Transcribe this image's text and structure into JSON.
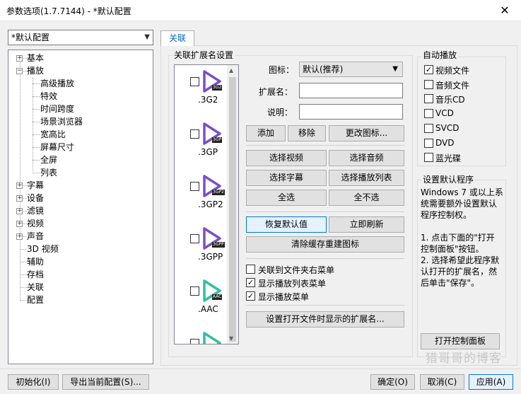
{
  "window": {
    "title": "参数选项(1.7.7144) - *默认配置",
    "close_glyph": "✕"
  },
  "profile": {
    "value": "*默认配置"
  },
  "tree": {
    "items": [
      {
        "label": "基本",
        "level": 0,
        "expander": "+"
      },
      {
        "label": "播放",
        "level": 0,
        "expander": "−"
      },
      {
        "label": "高级播放",
        "level": 1
      },
      {
        "label": "特效",
        "level": 1
      },
      {
        "label": "时间跨度",
        "level": 1
      },
      {
        "label": "场景浏览器",
        "level": 1
      },
      {
        "label": "宽高比",
        "level": 1
      },
      {
        "label": "屏幕尺寸",
        "level": 1
      },
      {
        "label": "全屏",
        "level": 1
      },
      {
        "label": "列表",
        "level": 1
      },
      {
        "label": "字幕",
        "level": 0,
        "expander": "+"
      },
      {
        "label": "设备",
        "level": 0,
        "expander": "+"
      },
      {
        "label": "滤镜",
        "level": 0,
        "expander": "+"
      },
      {
        "label": "视频",
        "level": 0,
        "expander": "+"
      },
      {
        "label": "声音",
        "level": 0,
        "expander": "+"
      },
      {
        "label": "3D 视频",
        "level": 0
      },
      {
        "label": "辅助",
        "level": 0
      },
      {
        "label": "存档",
        "level": 0
      },
      {
        "label": "关联",
        "level": 0
      },
      {
        "label": "配置",
        "level": 0
      }
    ]
  },
  "tab": {
    "label": "关联"
  },
  "assoc": {
    "group_title": "关联扩展名设置",
    "files": [
      {
        "badge": "3G2",
        "label": ".3G2",
        "color": "#7b4fc8"
      },
      {
        "badge": "3GP",
        "label": ".3GP",
        "color": "#7b4fc8"
      },
      {
        "badge": "3GP2",
        "label": ".3GP2",
        "color": "#7b4fc8"
      },
      {
        "badge": "3GPP",
        "label": ".3GPP",
        "color": "#7b4fc8"
      },
      {
        "badge": "AAC",
        "label": ".AAC",
        "color": "#2fbfa0"
      },
      {
        "badge": "",
        "label": "",
        "color": "#2fbfa0"
      }
    ],
    "icon_label": "图标：",
    "icon_value": "默认(推荐)",
    "ext_label": "扩展名：",
    "desc_label": "说明：",
    "buttons": {
      "add": "添加",
      "remove": "移除",
      "change_icon": "更改图标...",
      "select_video": "选择视频",
      "select_audio": "选择音频",
      "select_subtitle": "选择字幕",
      "select_playlist": "选择播放列表",
      "select_all": "全选",
      "select_none": "全不选",
      "restore_default": "恢复默认值",
      "refresh_now": "立即刷新",
      "clear_cache": "清除缓存重建图标",
      "set_open_ext": "设置打开文件时显示的扩展名..."
    },
    "checks": [
      {
        "label": "关联到文件夹右菜单",
        "checked": false
      },
      {
        "label": "显示播放列表菜单",
        "checked": true
      },
      {
        "label": "显示播放菜单",
        "checked": true
      }
    ]
  },
  "autoplay": {
    "title": "自动播放",
    "items": [
      {
        "label": "视频文件",
        "checked": true
      },
      {
        "label": "音频文件",
        "checked": false
      },
      {
        "label": "音乐CD",
        "checked": false
      },
      {
        "label": "VCD",
        "checked": false
      },
      {
        "label": "SVCD",
        "checked": false
      },
      {
        "label": "DVD",
        "checked": false
      },
      {
        "label": "蓝光碟",
        "checked": false
      }
    ]
  },
  "default_program": {
    "title": "设置默认程序",
    "lines": [
      "Windows 7 或以上系",
      "统需要额外设置默认",
      "程序控制权。",
      "",
      "1. 点击下面的\"打开",
      "控制面板\"按钮。",
      "2. 选择希望此程序默",
      "认打开的扩展名，然",
      "后单击\"保存\"。"
    ],
    "open_panel": "打开控制面板"
  },
  "footer": {
    "init": "初始化(I)",
    "export": "导出当前配置(S)...",
    "ok": "确定(O)",
    "cancel": "取消(C)",
    "apply": "应用(A)"
  },
  "watermark": "猎哥哥的博客"
}
